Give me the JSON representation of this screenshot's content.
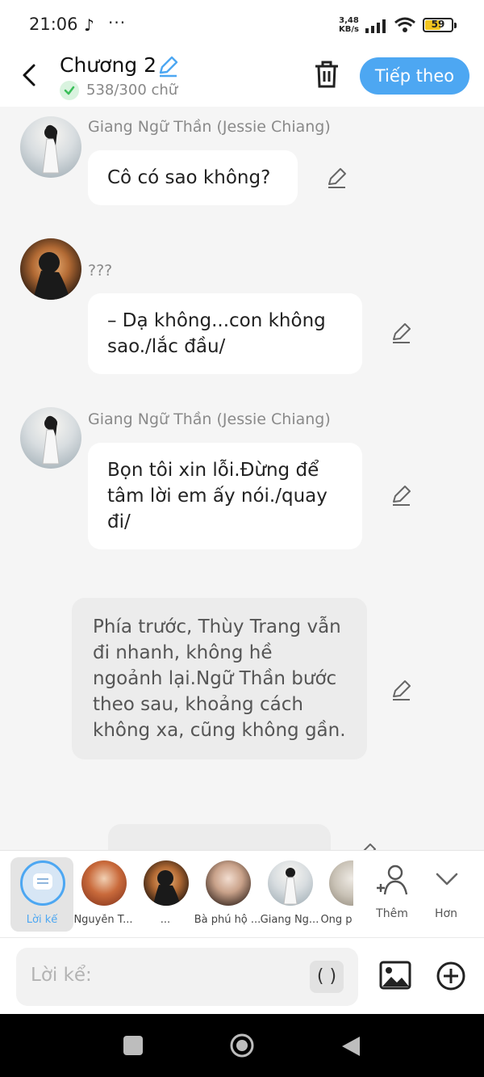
{
  "status_bar": {
    "time": "21:06",
    "net_speed_value": "3,48",
    "net_speed_unit": "KB/s",
    "battery_level": "59",
    "battery_fraction": 0.59
  },
  "header": {
    "title": "Chương 2",
    "word_count": "538/300 chữ",
    "next_label": "Tiếp theo"
  },
  "messages": [
    {
      "speaker": "Giang Ngữ Thần (Jessie Chiang)",
      "text": "Cô có sao không?"
    },
    {
      "speaker": "???",
      "text": "– Dạ không...con không sao./lắc đầu/"
    },
    {
      "speaker": "Giang Ngữ Thần (Jessie Chiang)",
      "text": "Bọn tôi xin lỗi.Đừng để tâm lời em ấy nói./quay đi/"
    },
    {
      "speaker": "",
      "text": "Phía trước, Thùy Trang vẫn đi nhanh, không hề ngoảnh lại.Ngữ Thần bước theo sau, khoảng cách không xa, cũng không gần."
    }
  ],
  "characters": [
    {
      "label": "Lời kể",
      "selected": true,
      "color": "#4da7f2"
    },
    {
      "label": "Nguyễn T..."
    },
    {
      "label": "..."
    },
    {
      "label": "Bà phú hộ ..."
    },
    {
      "label": "Giang Ng..."
    },
    {
      "label": "Ông p"
    }
  ],
  "char_actions": {
    "add_label": "Thêm",
    "more_label": "Hơn"
  },
  "input": {
    "placeholder": "Lời kể:",
    "paren_label": "( )"
  },
  "colors": {
    "accent": "#4da7f2",
    "narration_bg": "#ececec",
    "check": "#3bbf5a"
  }
}
